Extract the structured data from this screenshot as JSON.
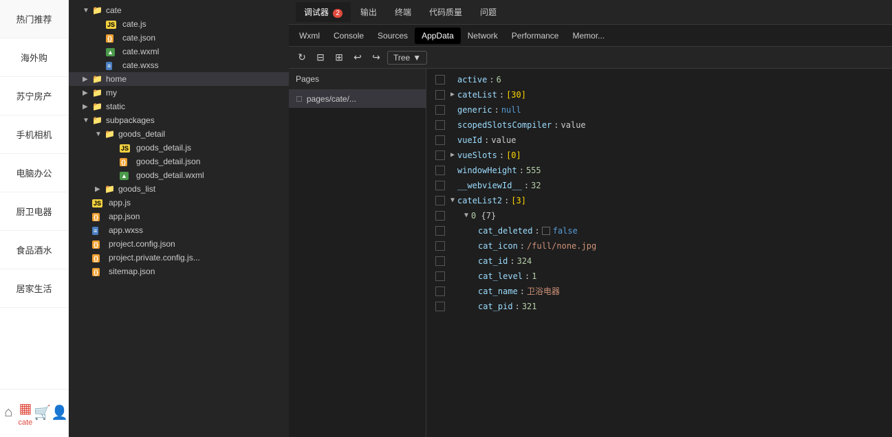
{
  "sidebar": {
    "items": [
      {
        "label": "热门推荐",
        "id": "hot"
      },
      {
        "label": "海外购",
        "id": "overseas"
      },
      {
        "label": "苏宁房产",
        "id": "realestate"
      },
      {
        "label": "手机相机",
        "id": "phone"
      },
      {
        "label": "电脑办公",
        "id": "computer"
      },
      {
        "label": "厨卫电器",
        "id": "kitchen"
      },
      {
        "label": "食品酒水",
        "id": "food"
      },
      {
        "label": "居家生活",
        "id": "home"
      }
    ],
    "tabs": [
      {
        "label": "home",
        "icon": "⌂",
        "active": false
      },
      {
        "label": "cate",
        "icon": "▦",
        "active": true
      },
      {
        "label": "cart",
        "icon": "🛒",
        "active": false
      },
      {
        "label": "user",
        "icon": "👤",
        "active": false
      }
    ]
  },
  "filetree": {
    "items": [
      {
        "indent": 0,
        "type": "folder",
        "name": "cate",
        "expanded": true,
        "level": 1
      },
      {
        "indent": 1,
        "type": "js",
        "name": "cate.js",
        "level": 2
      },
      {
        "indent": 1,
        "type": "json",
        "name": "cate.json",
        "level": 2
      },
      {
        "indent": 1,
        "type": "wxml",
        "name": "cate.wxml",
        "level": 2
      },
      {
        "indent": 1,
        "type": "wxss",
        "name": "cate.wxss",
        "level": 2
      },
      {
        "indent": 0,
        "type": "folder",
        "name": "home",
        "expanded": false,
        "level": 1,
        "selected": false
      },
      {
        "indent": 0,
        "type": "folder",
        "name": "my",
        "expanded": false,
        "level": 1
      },
      {
        "indent": 0,
        "type": "folder",
        "name": "static",
        "expanded": false,
        "level": 1
      },
      {
        "indent": 0,
        "type": "folder",
        "name": "subpackages",
        "expanded": true,
        "level": 1
      },
      {
        "indent": 1,
        "type": "folder",
        "name": "goods_detail",
        "expanded": true,
        "level": 2
      },
      {
        "indent": 2,
        "type": "js",
        "name": "goods_detail.js",
        "level": 3
      },
      {
        "indent": 2,
        "type": "json",
        "name": "goods_detail.json",
        "level": 3
      },
      {
        "indent": 2,
        "type": "wxml",
        "name": "goods_detail.wxml",
        "level": 3
      },
      {
        "indent": 1,
        "type": "folder",
        "name": "goods_list",
        "expanded": false,
        "level": 2
      },
      {
        "indent": 0,
        "type": "js",
        "name": "app.js",
        "level": 1
      },
      {
        "indent": 0,
        "type": "json",
        "name": "app.json",
        "level": 1
      },
      {
        "indent": 0,
        "type": "wxss",
        "name": "app.wxss",
        "level": 1
      },
      {
        "indent": 0,
        "type": "json",
        "name": "project.config.json",
        "level": 1
      },
      {
        "indent": 0,
        "type": "json",
        "name": "project.private.config.js...",
        "level": 1
      },
      {
        "indent": 0,
        "type": "json",
        "name": "sitemap.json",
        "level": 1
      }
    ]
  },
  "devtools": {
    "top_tabs": [
      {
        "label": "调试器",
        "badge": "2",
        "active": true
      },
      {
        "label": "输出",
        "active": false
      },
      {
        "label": "终端",
        "active": false
      },
      {
        "label": "代码质量",
        "active": false
      },
      {
        "label": "问题",
        "active": false
      }
    ],
    "sub_tabs": [
      {
        "label": "Wxml",
        "active": false
      },
      {
        "label": "Console",
        "active": false
      },
      {
        "label": "Sources",
        "active": false
      },
      {
        "label": "AppData",
        "active": true
      },
      {
        "label": "Network",
        "active": false
      },
      {
        "label": "Performance",
        "active": false
      },
      {
        "label": "Memor...",
        "active": false
      }
    ],
    "tree_label": "Tree",
    "pages_label": "Pages",
    "pages_item": "pages/cate/...",
    "appdata": [
      {
        "indent": 0,
        "key": "active",
        "colon": ":",
        "value": "6",
        "type": "num"
      },
      {
        "indent": 0,
        "key": "cateList",
        "colon": ":",
        "bracket": "[30]",
        "type": "array",
        "expandable": true
      },
      {
        "indent": 0,
        "key": "generic",
        "colon": ":",
        "value": "null",
        "type": "null"
      },
      {
        "indent": 0,
        "key": "scopedSlotsCompiler",
        "colon": ":",
        "value": "value",
        "type": "unquoted"
      },
      {
        "indent": 0,
        "key": "vueId",
        "colon": ":",
        "value": "value",
        "type": "unquoted"
      },
      {
        "indent": 0,
        "key": "vueSlots",
        "colon": ":",
        "bracket": "[0]",
        "type": "array",
        "expandable": true
      },
      {
        "indent": 0,
        "key": "windowHeight",
        "colon": ":",
        "value": "555",
        "type": "num"
      },
      {
        "indent": 0,
        "key": "__webviewId__",
        "colon": ":",
        "value": "32",
        "type": "num"
      },
      {
        "indent": 0,
        "key": "cateList2",
        "colon": ":",
        "bracket": "[3]",
        "type": "array",
        "expandable": true
      },
      {
        "indent": 1,
        "key": "0",
        "colon": "",
        "bracket": "{7}",
        "type": "object",
        "expandable": true
      },
      {
        "indent": 2,
        "key": "cat_deleted",
        "colon": ":",
        "value": "false",
        "type": "bool",
        "checkbox": true
      },
      {
        "indent": 2,
        "key": "cat_icon",
        "colon": ":",
        "value": "/full/none.jpg",
        "type": "string"
      },
      {
        "indent": 2,
        "key": "cat_id",
        "colon": ":",
        "value": "324",
        "type": "num"
      },
      {
        "indent": 2,
        "key": "cat_level",
        "colon": ":",
        "value": "1",
        "type": "num"
      },
      {
        "indent": 2,
        "key": "cat_name",
        "colon": ":",
        "value": "卫浴电器",
        "type": "string"
      },
      {
        "indent": 2,
        "key": "cat_pid",
        "colon": ":",
        "value": "321",
        "type": "num"
      }
    ]
  }
}
